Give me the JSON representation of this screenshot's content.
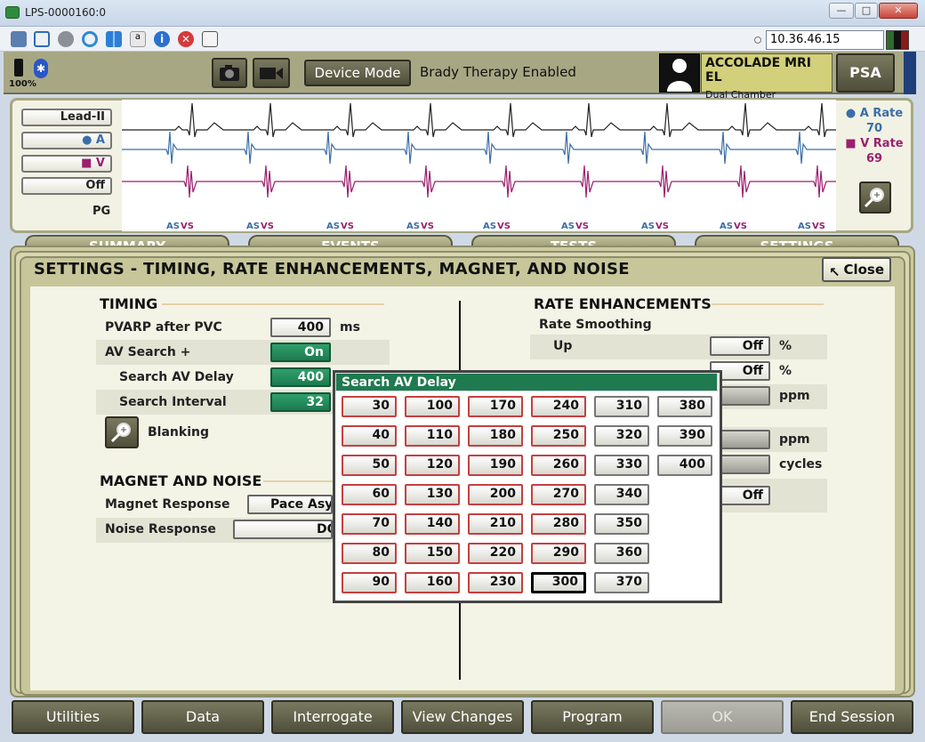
{
  "window": {
    "title": "LPS-0000160:0",
    "ip_address": "10.36.46.15"
  },
  "header": {
    "battery_pct": "100%",
    "device_mode_label": "Device Mode",
    "therapy_status": "Brady Therapy Enabled",
    "device_name": "ACCOLADE MRI EL",
    "device_type": "Dual Chamber Pacemaker",
    "psa_label": "PSA"
  },
  "ecg": {
    "lead_buttons": [
      "Lead-II",
      "● A",
      "■ V",
      "Off"
    ],
    "pg_label": "PG",
    "markers": [
      "AS",
      "VS"
    ],
    "a_rate_label": "● A Rate",
    "a_rate_value": "70",
    "v_rate_label": "■ V Rate",
    "v_rate_value": "69",
    "colors": {
      "a_channel": "#3a6ea8",
      "v_channel": "#9b1f6e",
      "surface": "#222222"
    }
  },
  "tabs": [
    "SUMMARY",
    "EVENTS",
    "TESTS",
    "SETTINGS"
  ],
  "panel": {
    "title": "SETTINGS - TIMING, RATE ENHANCEMENTS, MAGNET, AND NOISE",
    "close_label": "Close",
    "timing": {
      "heading": "TIMING",
      "pvarp_label": "PVARP after PVC",
      "pvarp_value": "400",
      "pvarp_unit": "ms",
      "avsearch_label": "AV Search +",
      "avsearch_value": "On",
      "search_av_delay_label": "Search AV Delay",
      "search_av_delay_value": "400",
      "search_interval_label": "Search Interval",
      "search_interval_value": "32",
      "blanking_label": "Blanking"
    },
    "magnet": {
      "heading": "MAGNET AND NOISE",
      "magnet_label": "Magnet Response",
      "magnet_value": "Pace Asy",
      "noise_label": "Noise Response",
      "noise_value": "DO"
    },
    "rate": {
      "heading": "RATE ENHANCEMENTS",
      "smoothing_label": "Rate Smoothing",
      "up_label": "Up",
      "up_value": "Off",
      "up_unit": "%",
      "down_value": "Off",
      "down_unit": "%",
      "ppm_unit_1": "ppm",
      "ppm_unit_2": "ppm",
      "cycles_unit": "cycles",
      "last_value": "Off"
    }
  },
  "popup": {
    "title": "Search AV Delay",
    "columns": [
      [
        "30",
        "40",
        "50",
        "60",
        "70",
        "80",
        "90"
      ],
      [
        "100",
        "110",
        "120",
        "130",
        "140",
        "150",
        "160"
      ],
      [
        "170",
        "180",
        "190",
        "200",
        "210",
        "220",
        "230"
      ],
      [
        "240",
        "250",
        "260",
        "270",
        "280",
        "290",
        "300"
      ],
      [
        "310",
        "320",
        "330",
        "340",
        "350",
        "360",
        "370"
      ],
      [
        "380",
        "390",
        "400"
      ]
    ],
    "selected": "300"
  },
  "bottom_buttons": [
    "Utilities",
    "Data",
    "Interrogate",
    "View Changes",
    "Program",
    "OK",
    "End Session"
  ]
}
